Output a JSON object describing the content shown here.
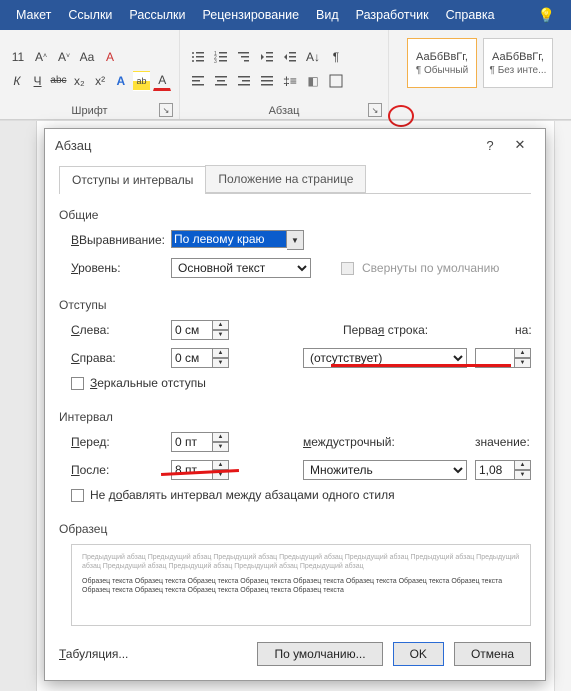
{
  "menu": {
    "items": [
      "Макет",
      "Ссылки",
      "Рассылки",
      "Рецензирование",
      "Вид",
      "Разработчик",
      "Справка"
    ]
  },
  "ribbon": {
    "font_label": "Шрифт",
    "para_label": "Абзац",
    "row1a": [
      "11",
      "A",
      "A",
      "Aa",
      "A"
    ],
    "row2a": [
      "К",
      "Ч",
      "abc",
      "x₂",
      "x²",
      "A",
      "ab",
      "A"
    ],
    "styles": [
      {
        "sample": "АаБбВвГг,",
        "name": "¶ Обычный"
      },
      {
        "sample": "АаБбВвГг,",
        "name": "¶ Без инте..."
      }
    ]
  },
  "dialog": {
    "title": "Абзац",
    "help": "?",
    "close": "✕",
    "tabs": {
      "active": "Отступы и интервалы",
      "inactive": "Положение на странице"
    },
    "general": {
      "legend": "Общие",
      "align_label": "Выравнивание:",
      "align_ul": "В",
      "align_value": "По левому краю",
      "level_label": "ровень:",
      "level_ul": "У",
      "level_value": "Основной текст",
      "collapse": "Свернуты по умолчанию"
    },
    "indent": {
      "legend": "Отступы",
      "left_label": "лева:",
      "left_ul": "С",
      "left_value": "0 см",
      "right_label": "права:",
      "right_ul": "С",
      "right_value": "0 см",
      "first_label": "Перва",
      "first_ul": "я",
      "first_label2": " строка:",
      "first_value": "(отсутствует)",
      "on_label": "а:",
      "on_ul": "н",
      "on_value": "",
      "mirror": "еркальные отступы",
      "mirror_ul": "З"
    },
    "spacing": {
      "legend": "Интервал",
      "before_label": "еред:",
      "before_ul": "П",
      "before_value": "0 пт",
      "after_label": "осле:",
      "after_ul": "П",
      "after_value": "8 пт",
      "line_label": "еждустрочный:",
      "line_ul": "м",
      "line_value": "Множитель",
      "val_label": "начение:",
      "val_ul": "з",
      "val_value": "1,08",
      "nosame": "Не д",
      "nosame_ul": "о",
      "nosame2": "бавлять интервал между абзацами одного стиля"
    },
    "preview": {
      "legend": "Образец",
      "grey": "Предыдущий абзац Предыдущий абзац Предыдущий абзац Предыдущий абзац Предыдущий абзац Предыдущий абзац Предыдущий абзац Предыдущий абзац Предыдущий абзац Предыдущий абзац Предыдущий абзац",
      "dark": "Образец текста Образец текста Образец текста Образец текста Образец текста Образец текста Образец текста Образец текста Образец текста Образец текста Образец текста Образец текста Образец текста"
    },
    "buttons": {
      "tabs": "абуляция...",
      "tabs_ul": "Т",
      "default": "По умолчанию...",
      "ok": "OK",
      "cancel": "Отмена"
    }
  }
}
